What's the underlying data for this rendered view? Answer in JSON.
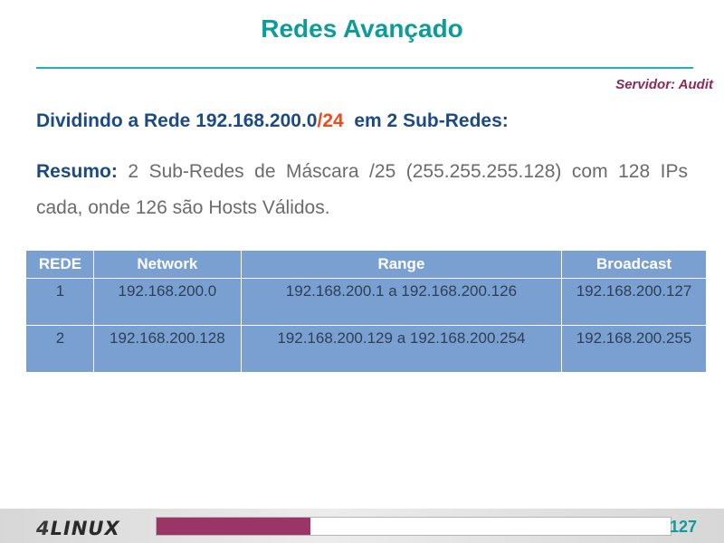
{
  "slide": {
    "title": "Redes Avançado",
    "server_label": "Servidor: Audit",
    "heading_prefix": "Dividindo a Rede 192.168.200.0",
    "heading_mask": "/24",
    "heading_suffix": "  em 2 Sub-Redes:",
    "summary_label": "Resumo:",
    "summary_text": " 2 Sub-Redes de Máscara /25 (255.255.255.128) com 128 IPs cada, onde 126 são Hosts Válidos."
  },
  "table": {
    "headers": [
      "REDE",
      "Network",
      "Range",
      "Broadcast"
    ],
    "rows": [
      [
        "1",
        "192.168.200.0",
        "192.168.200.1 a 192.168.200.126",
        "192.168.200.127"
      ],
      [
        "2",
        "192.168.200.128",
        "192.168.200.129 a 192.168.200.254",
        "192.168.200.255"
      ]
    ]
  },
  "footer": {
    "logo_number": "4",
    "logo_text": "LINUX",
    "progress_fraction": 0.3,
    "page_number": "127"
  },
  "colors": {
    "title": "#0e9c9a",
    "heading": "#1b4b82",
    "mask_accent": "#ee4b1a",
    "server": "#8b2a57",
    "table_bg": "#7aa0d1",
    "progress": "#9b3565"
  }
}
